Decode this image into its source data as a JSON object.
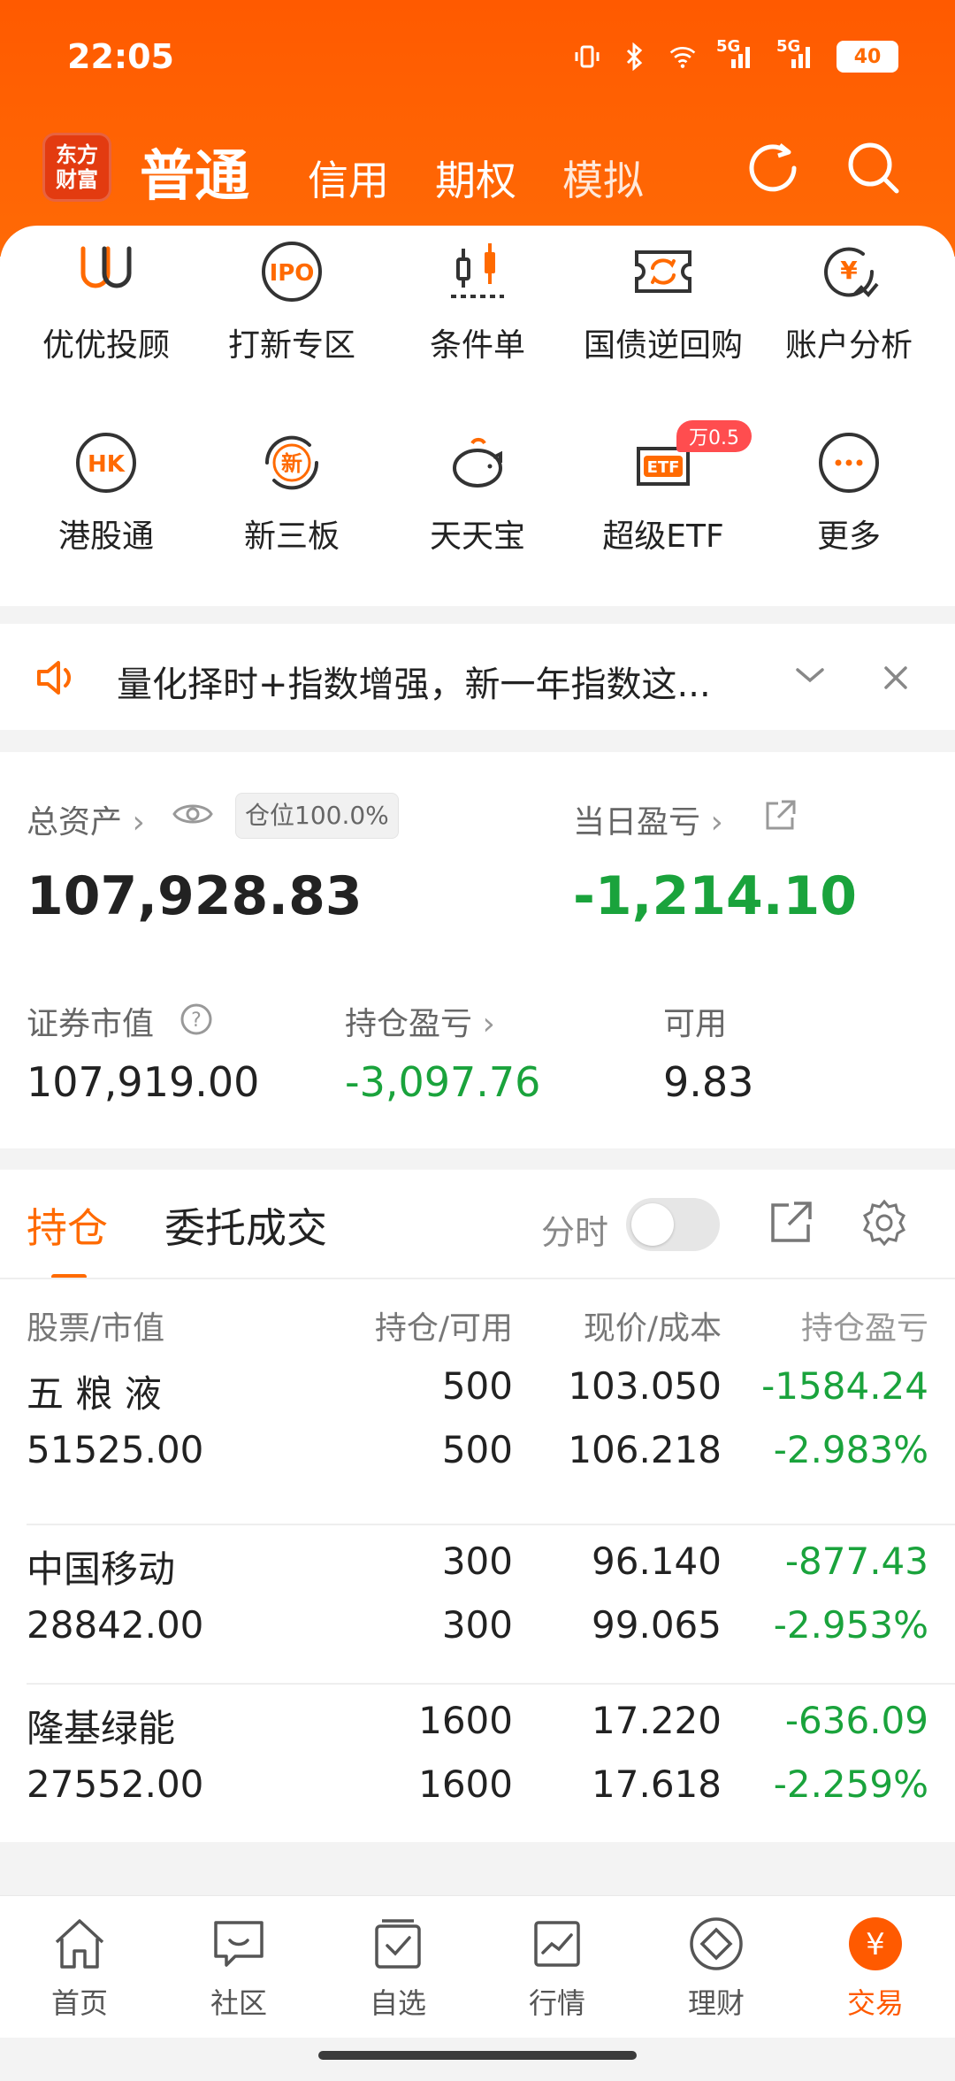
{
  "status": {
    "time": "22:05",
    "signal1": "5G",
    "signal2": "5G",
    "battery": "40"
  },
  "header": {
    "logo_line1": "东方",
    "logo_line2": "财富",
    "tab_active": "普通",
    "tabs": [
      "信用",
      "期权",
      "模拟"
    ]
  },
  "shortcuts": [
    {
      "label": "优优投顾",
      "icon": "uu-advisor-icon"
    },
    {
      "label": "打新专区",
      "icon": "ipo-icon"
    },
    {
      "label": "条件单",
      "icon": "conditional-order-icon"
    },
    {
      "label": "国债逆回购",
      "icon": "bond-repo-icon"
    },
    {
      "label": "账户分析",
      "icon": "account-analysis-icon"
    },
    {
      "label": "港股通",
      "icon": "hk-connect-icon"
    },
    {
      "label": "新三板",
      "icon": "new-third-board-icon"
    },
    {
      "label": "天天宝",
      "icon": "piggy-bank-icon"
    },
    {
      "label": "超级ETF",
      "icon": "etf-icon",
      "badge": "万0.5"
    },
    {
      "label": "更多",
      "icon": "more-icon"
    }
  ],
  "notice": {
    "text": "量化择时+指数增强，新一年指数这..."
  },
  "assets": {
    "total_label": "总资产",
    "position_pill": "仓位100.0%",
    "total_value": "107,928.83",
    "daily_label": "当日盈亏",
    "daily_value": "-1,214.10",
    "market_label": "证券市值",
    "market_value": "107,919.00",
    "holding_label": "持仓盈亏",
    "holding_value": "-3,097.76",
    "available_label": "可用",
    "available_value": "9.83"
  },
  "positions": {
    "tab_active": "持仓",
    "tab_other": "委托成交",
    "toggle_label": "分时",
    "columns": [
      "股票/市值",
      "持仓/可用",
      "现价/成本",
      "持仓盈亏"
    ],
    "rows": [
      {
        "name": "五 粮 液",
        "market": "51525.00",
        "hold": "500",
        "avail": "500",
        "price": "103.050",
        "cost": "106.218",
        "pl": "-1584.24",
        "plpct": "-2.983%"
      },
      {
        "name": "中国移动",
        "market": "28842.00",
        "hold": "300",
        "avail": "300",
        "price": "96.140",
        "cost": "99.065",
        "pl": "-877.43",
        "plpct": "-2.953%"
      },
      {
        "name": "隆基绿能",
        "market": "27552.00",
        "hold": "1600",
        "avail": "1600",
        "price": "17.220",
        "cost": "17.618",
        "pl": "-636.09",
        "plpct": "-2.259%"
      }
    ]
  },
  "bottom_nav": [
    {
      "label": "首页",
      "icon": "home-icon"
    },
    {
      "label": "社区",
      "icon": "community-icon"
    },
    {
      "label": "自选",
      "icon": "watchlist-icon"
    },
    {
      "label": "行情",
      "icon": "market-icon"
    },
    {
      "label": "理财",
      "icon": "wealth-icon"
    },
    {
      "label": "交易",
      "icon": "trade-icon",
      "active": true
    }
  ],
  "colors": {
    "brand": "#ff6a00",
    "down": "#1aa33c"
  }
}
